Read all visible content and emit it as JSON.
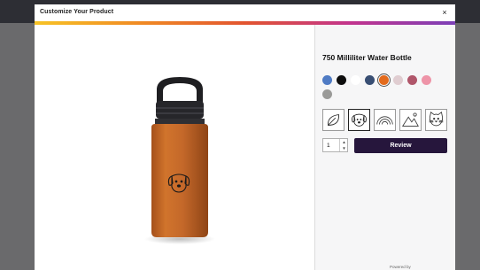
{
  "modal": {
    "title": "Customize Your Product",
    "close_label": "×"
  },
  "gradient_colors": [
    "#f7c325",
    "#f08a24",
    "#e2542f",
    "#c2338d",
    "#7b3fb7"
  ],
  "product": {
    "title": "750 Milliliter Water Bottle",
    "bottle_color": "#c96a24"
  },
  "colors": [
    {
      "name": "blue",
      "hex": "#4f7bc4"
    },
    {
      "name": "black",
      "hex": "#0d0d0d"
    },
    {
      "name": "white",
      "hex": "#ffffff"
    },
    {
      "name": "navy",
      "hex": "#384e73"
    },
    {
      "name": "orange",
      "hex": "#e36a1c",
      "selected": true
    },
    {
      "name": "light-pink",
      "hex": "#e0cdd1"
    },
    {
      "name": "berry",
      "hex": "#b0566a"
    },
    {
      "name": "pink",
      "hex": "#ee94a8"
    },
    {
      "name": "gray",
      "hex": "#9a9a98"
    }
  ],
  "designs": [
    {
      "name": "leaf-icon"
    },
    {
      "name": "dog-icon",
      "selected": true
    },
    {
      "name": "rainbow-icon"
    },
    {
      "name": "mountains-icon"
    },
    {
      "name": "cat-icon"
    }
  ],
  "quantity": {
    "value": "1",
    "increment_label": "▲",
    "decrement_label": "▼"
  },
  "review_label": "Review",
  "powered_by": "Powered by"
}
